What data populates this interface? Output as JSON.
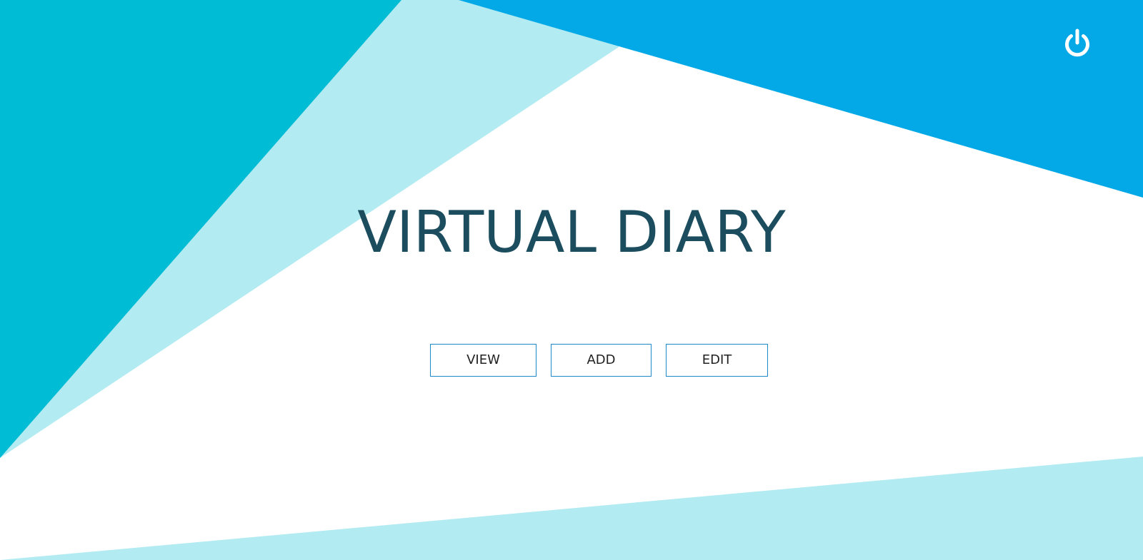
{
  "page": {
    "title": "VIRTUAL DIARY"
  },
  "header": {
    "power_icon": "power-icon"
  },
  "actions": {
    "view_label": "VIEW",
    "add_label": "ADD",
    "edit_label": "EDIT"
  },
  "colors": {
    "teal": "#00bcd4",
    "light_cyan": "#b2ebf2",
    "sky_blue": "#03a9e6",
    "title_text": "#1b4d5e",
    "button_border": "#1e88c8"
  }
}
